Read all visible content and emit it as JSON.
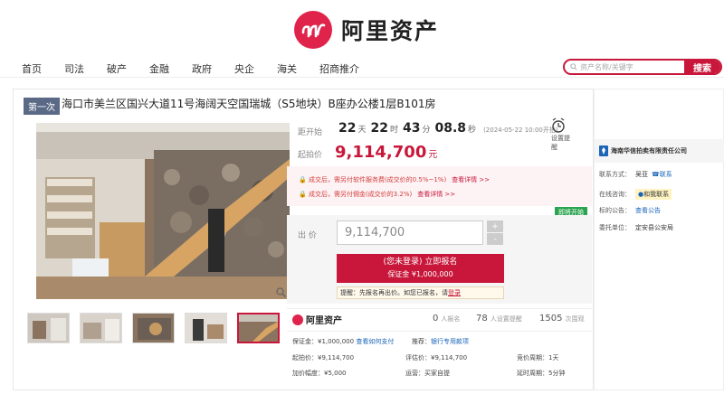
{
  "brand": {
    "name": "阿里资产",
    "color": "#e0234a"
  },
  "nav": [
    "首页",
    "司法",
    "破产",
    "金融",
    "政府",
    "央企",
    "海关",
    "招商推介"
  ],
  "search": {
    "placeholder": "资产名称/关键字",
    "button": "搜索"
  },
  "lot": {
    "round": "第一次",
    "title": "海口市美兰区国兴大道11号海阔天空国瑞城（S5地块）B座办公楼1层B101房",
    "countdown_label": "距开始",
    "days": "22",
    "hours": "22",
    "minutes": "43",
    "seconds": "08.8",
    "u_day": "天",
    "u_hour": "时",
    "u_min": "分",
    "u_sec": "秒",
    "start_time": "(2024-05-22 10:00开拍)",
    "start_price_label": "起拍价",
    "start_price": "9,114,700",
    "currency_unit": "元",
    "alarm_label": "设置提醒"
  },
  "fees": [
    {
      "text": "成交后，需另付软件服务费(成交价的0.5%~1%)",
      "link": "查看详情 >>"
    },
    {
      "text": "成交后，需另付佣金(成交价的3.2%)",
      "link": "查看详情 >>"
    }
  ],
  "status_tag": "即将开始",
  "bid": {
    "label": "出 价",
    "value": "9,114,700",
    "plus": "+",
    "minus": "-",
    "register_line1": "(您未登录) 立即报名",
    "register_line2": "保证金 ¥1,000,000",
    "tip_prefix": "提醒：先报名再出价。如您已报名，请",
    "tip_link": "登录"
  },
  "stats": {
    "brand": "阿里资产",
    "applicants": "0",
    "applicants_label": "人报名",
    "reminders": "78",
    "reminders_label": "人设置提醒",
    "views": "1505",
    "views_label": "次围观"
  },
  "details": {
    "deposit": "保证金：¥1,000,000",
    "deposit_link": "查看如何支付",
    "recommend": "推荐：",
    "recommend_link": "银行专用款项",
    "start_price": "起拍价：¥9,114,700",
    "increment": "加价幅度：¥5,000",
    "eval_price": "评估价：¥9,114,700",
    "escrow": "运营：买家自提",
    "period": "竞价周期：1天",
    "extension": "延时周期：5分钟"
  },
  "seller": {
    "name": "海南华信拍卖有限责任公司",
    "contact_label": "联系方式：",
    "contact_name": "吴亚",
    "contact_link": "联系",
    "online_label": "在线咨询：",
    "online_link": "和我联系",
    "notice_label": "标的公告：",
    "notice_link": "查看公告",
    "entrust_label": "委托单位：",
    "entrust_value": "定安县公安局"
  },
  "thumb_count": 5
}
